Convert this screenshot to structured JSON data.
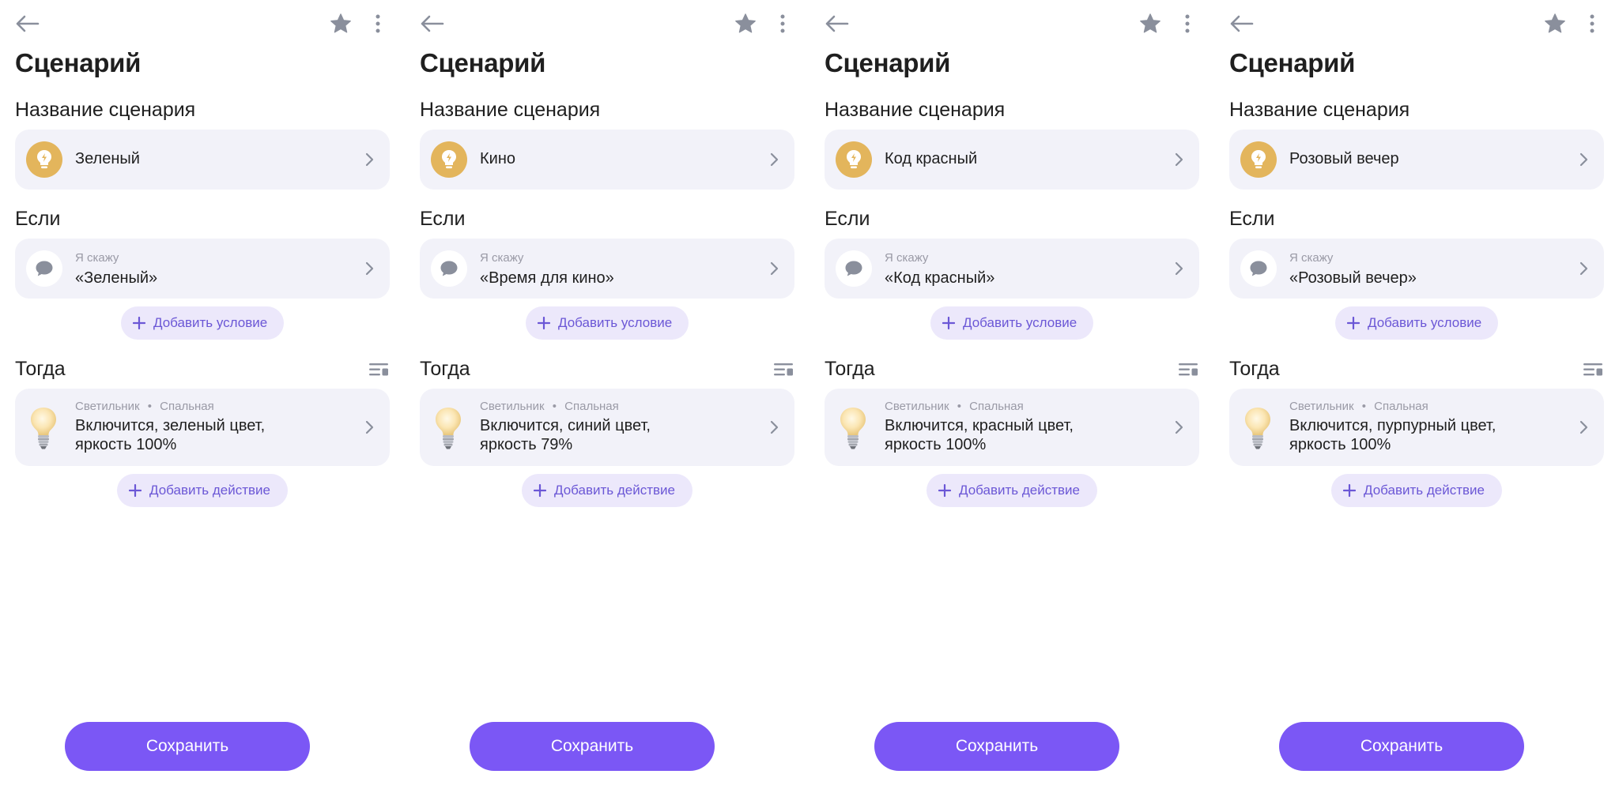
{
  "screens": [
    {
      "page_title": "Сценарий",
      "name_section_title": "Название сценария",
      "scenario_name": "Зеленый",
      "if_section_title": "Если",
      "trigger_label": "Я скажу",
      "trigger_phrase": "«Зеленый»",
      "add_condition_label": "Добавить условие",
      "then_section_title": "Тогда",
      "device_name": "Светильник",
      "room_name": "Спальная",
      "action_line1": "Включится, зеленый цвет,",
      "action_line2": "яркость 100%",
      "add_action_label": "Добавить действие",
      "save_label": "Сохранить"
    },
    {
      "page_title": "Сценарий",
      "name_section_title": "Название сценария",
      "scenario_name": "Кино",
      "if_section_title": "Если",
      "trigger_label": "Я скажу",
      "trigger_phrase": "«Время для кино»",
      "add_condition_label": "Добавить условие",
      "then_section_title": "Тогда",
      "device_name": "Светильник",
      "room_name": "Спальная",
      "action_line1": "Включится, синий цвет,",
      "action_line2": "яркость 79%",
      "add_action_label": "Добавить действие",
      "save_label": "Сохранить"
    },
    {
      "page_title": "Сценарий",
      "name_section_title": "Название сценария",
      "scenario_name": "Код красный",
      "if_section_title": "Если",
      "trigger_label": "Я скажу",
      "trigger_phrase": "«Код красный»",
      "add_condition_label": "Добавить условие",
      "then_section_title": "Тогда",
      "device_name": "Светильник",
      "room_name": "Спальная",
      "action_line1": "Включится, красный цвет,",
      "action_line2": "яркость 100%",
      "add_action_label": "Добавить действие",
      "save_label": "Сохранить"
    },
    {
      "page_title": "Сценарий",
      "name_section_title": "Название сценария",
      "scenario_name": "Розовый вечер",
      "if_section_title": "Если",
      "trigger_label": "Я скажу",
      "trigger_phrase": "«Розовый вечер»",
      "add_condition_label": "Добавить условие",
      "then_section_title": "Тогда",
      "device_name": "Светильник",
      "room_name": "Спальная",
      "action_line1": "Включится, пурпурный цвет,",
      "action_line2": "яркость 100%",
      "add_action_label": "Добавить действие",
      "save_label": "Сохранить"
    }
  ],
  "separator": "•",
  "icons": {
    "back": "arrow-left-icon",
    "favorite": "star-icon",
    "more": "more-vertical-icon",
    "scenario": "lightbulb-bolt-icon",
    "voice_trigger": "speech-bubble-icon",
    "add": "plus-icon",
    "chevron": "chevron-right-icon",
    "reorder": "list-settings-icon",
    "device": "lamp-bulb-icon"
  },
  "colors": {
    "accent": "#7b57f5",
    "pill_bg": "#ece8fb",
    "pill_text": "#6b57d6",
    "card_bg": "#f2f2f9",
    "scenario_icon_bg": "#e3b55c",
    "icon_gray": "#8a8f9c"
  }
}
